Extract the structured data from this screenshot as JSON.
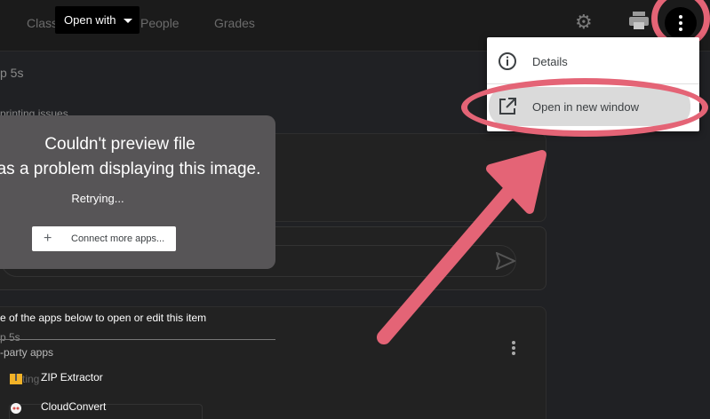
{
  "nav": {
    "tabs": [
      "Classwork",
      "People",
      "Grades"
    ]
  },
  "background": {
    "text_5s_top": "p 5s",
    "text_printing": "printing issues",
    "text_5s_mid": "p 5s",
    "text_ting": "ting"
  },
  "toolbar": {
    "open_with_label": "Open with"
  },
  "menu": {
    "details_label": "Details",
    "open_new_window_label": "Open in new window"
  },
  "preview": {
    "title": "Couldn't preview file",
    "subtitle": "as a problem displaying this image.",
    "status": "Retrying...",
    "connect_button": "Connect more apps..."
  },
  "apps": {
    "heading": "e of the apps below to open or edit this item",
    "third_party_label": "-party apps",
    "items": [
      {
        "name": "ZIP Extractor",
        "icon": "zip-icon"
      },
      {
        "name": "CloudConvert",
        "icon": "cloud-icon"
      }
    ]
  },
  "colors": {
    "highlight": "#e46476",
    "menu_bg": "#ffffff",
    "preview_bg": "#575557"
  }
}
